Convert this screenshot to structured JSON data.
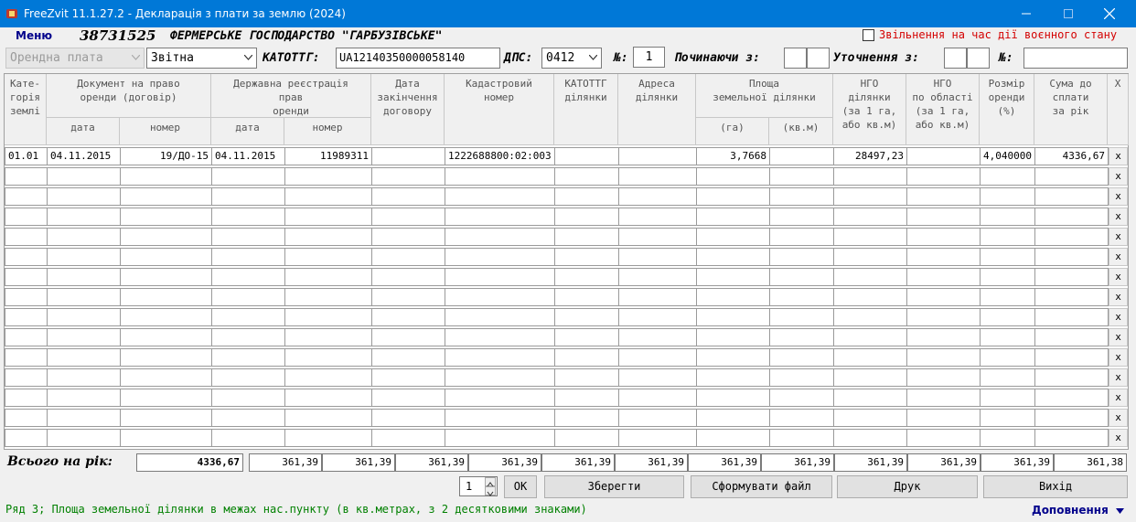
{
  "window": {
    "title": "FreeZvit 11.1.27.2 - Декларація з плати за землю (2024)"
  },
  "header": {
    "menu_label": "Меню",
    "org_code": "38731525",
    "org_name": "ФЕРМЕРСЬКЕ ГОСПОДАРСТВО \"ГАРБУЗІВСЬКЕ\"",
    "war_exemption_label": "Звільнення на час дії воєнного стану",
    "war_exemption_checked": false
  },
  "form": {
    "payment_type": "Орендна плата",
    "report_type": "Звітна",
    "katottg_label": "КАТОТТГ:",
    "katottg_value": "UA12140350000058140",
    "dps_label": "ДПС:",
    "dps_value": "0412",
    "number_label": "№:",
    "number_value": "1",
    "starting_from_label": "Починаючи з:",
    "starting_from_1": "",
    "starting_from_2": "",
    "clarification_label": "Уточнення з:",
    "clarification_1": "",
    "clarification_2": "",
    "number2_label": "№:",
    "number2_value": ""
  },
  "grid": {
    "headers": {
      "category": "Кате-\nгорія\nземлі",
      "lease_doc": "Документ на право\nоренди (договір)",
      "lease_doc_date": "дата",
      "lease_doc_number": "номер",
      "state_reg": "Державна реєстрація\nправ\nоренди",
      "state_reg_date": "дата",
      "state_reg_number": "номер",
      "end_date": "Дата\nзакінчення\nдоговору",
      "cadastral": "Кадастровий\nномер",
      "plot_katottg": "КАТОТТГ\nділянки",
      "plot_address": "Адреса\nділянки",
      "area": "Площа\nземельної ділянки",
      "area_ha": "(га)",
      "area_sqm": "(кв.м)",
      "ngo_plot": "НГО\nділянки\n(за 1 га,\nабо кв.м)",
      "ngo_region": "НГО\nпо області\n(за 1 га,\nабо кв.м)",
      "rent_size": "Розмір\nоренди\n(%)",
      "sum_due": "Сума до\nсплати\nза рік",
      "x": "X"
    },
    "rows": [
      {
        "category": "01.01",
        "doc_date": "04.11.2015",
        "doc_number": "19/ДО-15",
        "reg_date": "04.11.2015",
        "reg_number": "11989311",
        "end_date": "",
        "cadastral": "1222688800:02:003",
        "katottg": "",
        "address": "",
        "area_ha": "3,7668",
        "area_sqm": "",
        "ngo_plot": "28497,23",
        "ngo_region": "",
        "rent_size": "4,040000",
        "sum": "4336,67"
      },
      {},
      {},
      {},
      {},
      {},
      {},
      {},
      {},
      {},
      {},
      {},
      {},
      {},
      {}
    ],
    "row_x_label": "x"
  },
  "totals": {
    "label": "Всього на рік:",
    "annual": "4336,67",
    "monthly": [
      "361,39",
      "361,39",
      "361,39",
      "361,39",
      "361,39",
      "361,39",
      "361,39",
      "361,39",
      "361,39",
      "361,39",
      "361,39",
      "361,38"
    ]
  },
  "footer": {
    "spinner_value": "1",
    "ok_label": "OK",
    "save_label": "Зберегти",
    "make_file_label": "Сформувати файл",
    "print_label": "Друк",
    "exit_label": "Вихід",
    "status_text": "Ряд 3; Площа земельної ділянки в межах нас.пункту (в кв.метрах, з 2 десятковими знаками)",
    "additions_label": "Доповнення"
  },
  "colors": {
    "titlebar": "#0078d7",
    "status": "#008000",
    "warning": "#d40000",
    "menu": "#00008b"
  }
}
